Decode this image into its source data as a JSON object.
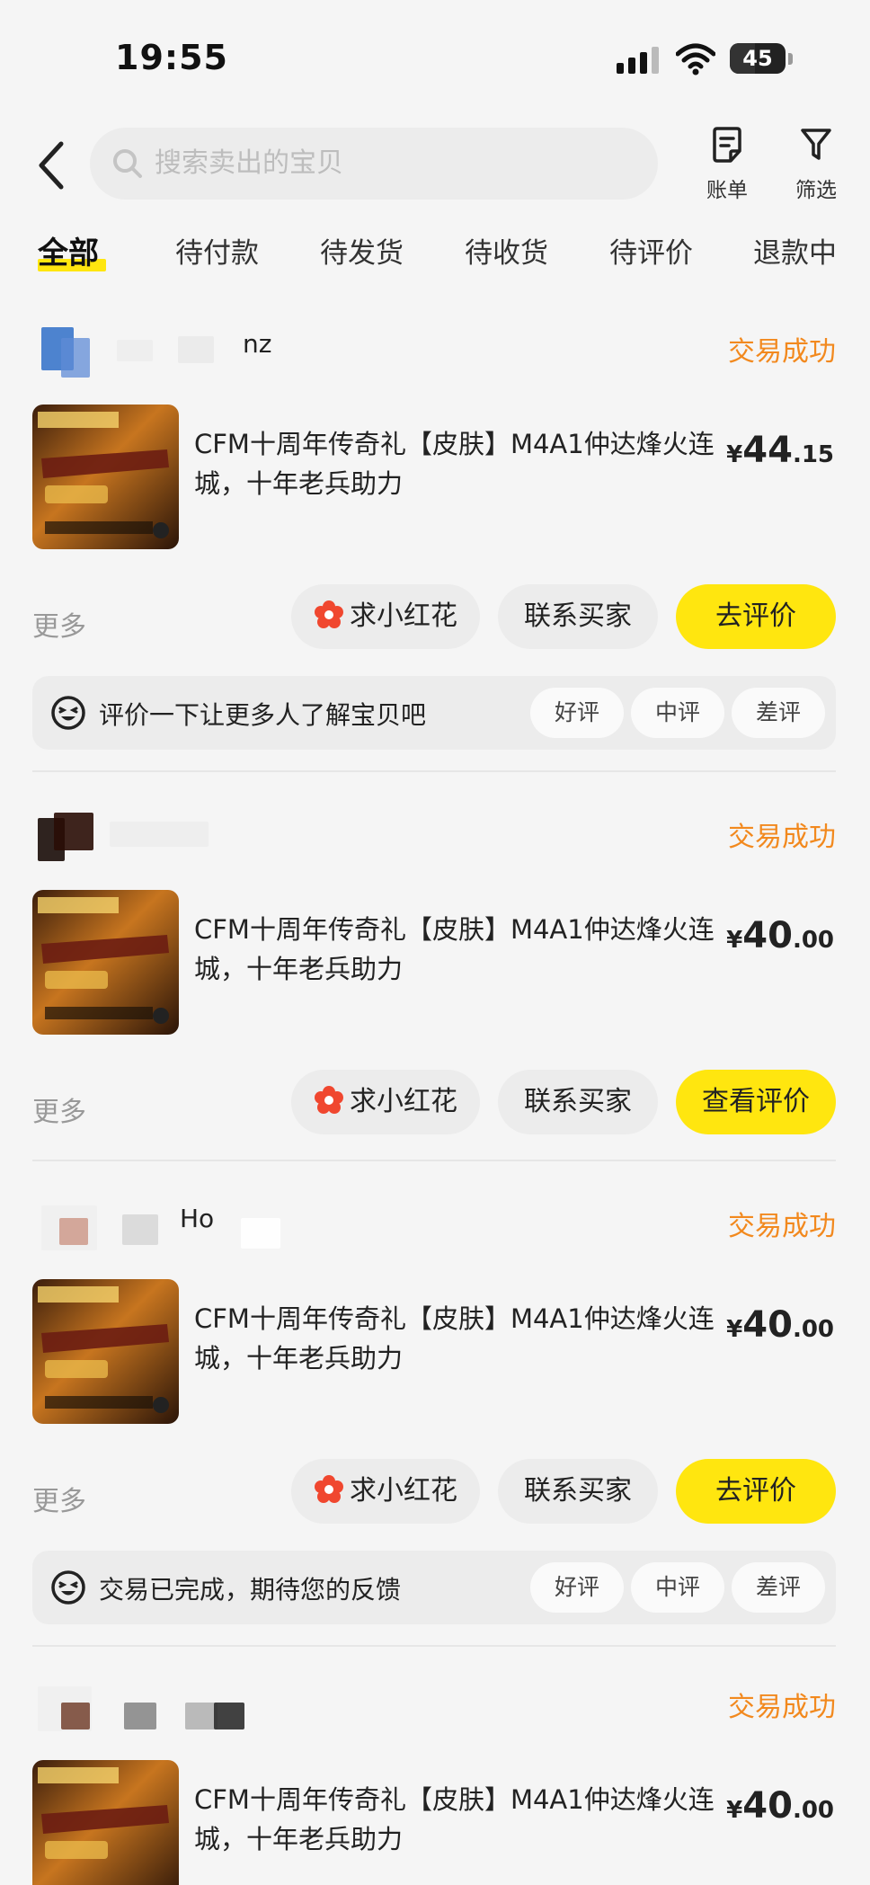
{
  "status_bar": {
    "time": "19:55",
    "battery": "45",
    "battery_level": 0.45
  },
  "search": {
    "placeholder": "搜索卖出的宝贝"
  },
  "top_actions": {
    "bill_label": "账单",
    "filter_label": "筛选"
  },
  "tabs": [
    "全部",
    "待付款",
    "待发货",
    "待收货",
    "待评价",
    "退款中"
  ],
  "active_tab": "全部",
  "orders": [
    {
      "buyer_name": "nz",
      "status": "交易成功",
      "title": "CFM十周年传奇礼【皮肤】M4A1仲达烽火连城，十年老兵助力",
      "price_currency": "¥",
      "price_int": "44",
      "price_dec": ".15",
      "more": "更多",
      "flower_button": "求小红花",
      "contact_button": "联系买家",
      "main_button": "去评价",
      "review_prompt": "评价一下让更多人了解宝贝吧",
      "review_options": [
        "好评",
        "中评",
        "差评"
      ]
    },
    {
      "buyer_name": "",
      "status": "交易成功",
      "title": "CFM十周年传奇礼【皮肤】M4A1仲达烽火连城，十年老兵助力",
      "price_currency": "¥",
      "price_int": "40",
      "price_dec": ".00",
      "more": "更多",
      "flower_button": "求小红花",
      "contact_button": "联系买家",
      "main_button": "查看评价"
    },
    {
      "buyer_name": "Ho",
      "status": "交易成功",
      "title": "CFM十周年传奇礼【皮肤】M4A1仲达烽火连城，十年老兵助力",
      "price_currency": "¥",
      "price_int": "40",
      "price_dec": ".00",
      "more": "更多",
      "flower_button": "求小红花",
      "contact_button": "联系买家",
      "main_button": "去评价",
      "review_prompt": "交易已完成，期待您的反馈",
      "review_options": [
        "好评",
        "中评",
        "差评"
      ]
    },
    {
      "buyer_name": "",
      "status": "交易成功",
      "title": "CFM十周年传奇礼【皮肤】M4A1仲达烽火连城，十年老兵助力",
      "price_currency": "¥",
      "price_int": "40",
      "price_dec": ".00"
    }
  ],
  "colors": {
    "accent_yellow": "#ffe60f",
    "status_orange": "#f2891e",
    "background": "#f5f5f5"
  }
}
